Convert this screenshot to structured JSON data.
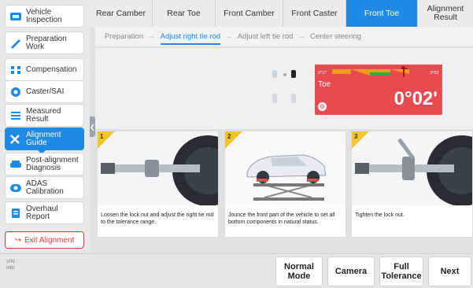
{
  "sidebar": {
    "items": [
      {
        "label": "Vehicle Inspection",
        "icon": "car-scan-icon"
      },
      {
        "label": "Preparation Work",
        "icon": "wrench-icon"
      },
      {
        "label": "Compensation",
        "icon": "compensation-icon"
      },
      {
        "label": "Caster/SAI",
        "icon": "wheel-icon"
      },
      {
        "label": "Measured Result",
        "icon": "table-icon"
      },
      {
        "label": "Alignment Guide",
        "icon": "tools-icon"
      },
      {
        "label": "Post-alignment Diagnosis",
        "icon": "car-icon"
      },
      {
        "label": "ADAS Calibration",
        "icon": "adas-icon"
      },
      {
        "label": "Overhaul Report",
        "icon": "report-icon"
      }
    ],
    "active_index": 5,
    "exit_label": "Exit Alignment"
  },
  "tabs": [
    {
      "label": "Rear Camber"
    },
    {
      "label": "Rear Toe"
    },
    {
      "label": "Front Camber"
    },
    {
      "label": "Front Caster"
    },
    {
      "label": "Front Toe"
    },
    {
      "label": "Alignment Result"
    }
  ],
  "active_tab": 4,
  "steps": [
    {
      "label": "Preparation"
    },
    {
      "label": "Adjust right tie rod"
    },
    {
      "label": "Adjust left tie rod"
    },
    {
      "label": "Center steering"
    }
  ],
  "active_step": 1,
  "readout": {
    "label": "Toe",
    "value": "0°02'",
    "scale_min": "0°17'",
    "scale_max": "0°03'",
    "panel_color": "#e84b4f"
  },
  "guide": [
    {
      "num": "1",
      "caption": "Loosen the lock nut and adjust the right tie rod to the tolerance range."
    },
    {
      "num": "2",
      "caption": "Jounce the front part of the vehicle to set all bottom components in natural status."
    },
    {
      "num": "3",
      "caption": "Tighten the lock nut."
    }
  ],
  "bottom": {
    "vin_label": "VIN:",
    "info_label": "Info:",
    "buttons": {
      "normal_mode": "Normal Mode",
      "camera": "Camera",
      "full_tolerance": "Full Tolerance",
      "next": "Next"
    }
  },
  "colors": {
    "accent": "#1e8ae6",
    "alert": "#e84b4f",
    "exit": "#e23b3b",
    "step_badge": "#f5c52c"
  }
}
